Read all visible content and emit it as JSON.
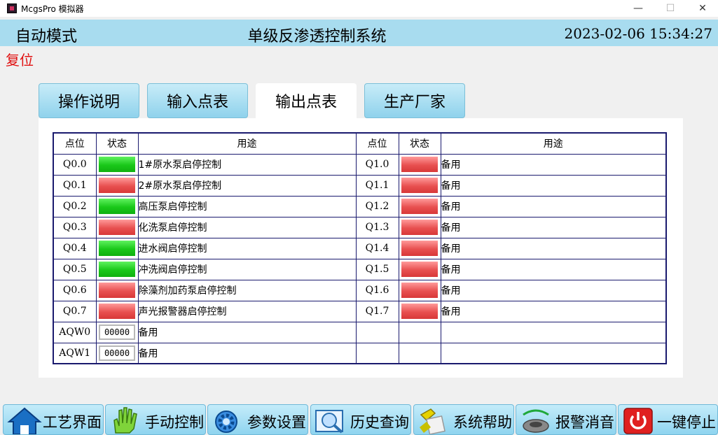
{
  "window": {
    "title": "McgsPro 模拟器",
    "min": "—",
    "max": "☐",
    "close": "✕"
  },
  "header": {
    "mode": "自动模式",
    "title": "单级反渗透控制系统",
    "datetime": "2023-02-06 15:34:27"
  },
  "reset_label": "复位",
  "tabs": [
    {
      "label": "操作说明",
      "active": false
    },
    {
      "label": "输入点表",
      "active": false
    },
    {
      "label": "输出点表",
      "active": true
    },
    {
      "label": "生产厂家",
      "active": false
    }
  ],
  "table": {
    "headers": {
      "addr": "点位",
      "status": "状态",
      "use": "用途"
    },
    "left": [
      {
        "addr": "Q0.0",
        "status": "on",
        "use": "1#原水泵启停控制"
      },
      {
        "addr": "Q0.1",
        "status": "off",
        "use": "2#原水泵启停控制"
      },
      {
        "addr": "Q0.2",
        "status": "on",
        "use": "高压泵启停控制"
      },
      {
        "addr": "Q0.3",
        "status": "off",
        "use": "化洗泵启停控制"
      },
      {
        "addr": "Q0.4",
        "status": "on",
        "use": "进水阀启停控制"
      },
      {
        "addr": "Q0.5",
        "status": "on",
        "use": "冲洗阀启停控制"
      },
      {
        "addr": "Q0.6",
        "status": "off",
        "use": "除藻剂加药泵启停控制"
      },
      {
        "addr": "Q0.7",
        "status": "off",
        "use": "声光报警器启停控制"
      },
      {
        "addr": "AQW0",
        "value": "00000",
        "use": "备用"
      },
      {
        "addr": "AQW1",
        "value": "00000",
        "use": "备用"
      }
    ],
    "right": [
      {
        "addr": "Q1.0",
        "status": "off",
        "use": "备用"
      },
      {
        "addr": "Q1.1",
        "status": "off",
        "use": "备用"
      },
      {
        "addr": "Q1.2",
        "status": "off",
        "use": "备用"
      },
      {
        "addr": "Q1.3",
        "status": "off",
        "use": "备用"
      },
      {
        "addr": "Q1.4",
        "status": "off",
        "use": "备用"
      },
      {
        "addr": "Q1.5",
        "status": "off",
        "use": "备用"
      },
      {
        "addr": "Q1.6",
        "status": "off",
        "use": "备用"
      },
      {
        "addr": "Q1.7",
        "status": "off",
        "use": "备用"
      }
    ]
  },
  "colors": {
    "on": "#1ac81a",
    "off": "#e85050",
    "header_bg": "#a8dcef",
    "reset": "#e01010"
  },
  "nav": [
    {
      "label": "工艺界面",
      "icon": "home-icon"
    },
    {
      "label": "手动控制",
      "icon": "hand-icon"
    },
    {
      "label": "参数设置",
      "icon": "gear-icon"
    },
    {
      "label": "历史查询",
      "icon": "magnifier-icon"
    },
    {
      "label": "系统帮助",
      "icon": "help-icon"
    },
    {
      "label": "报警消音",
      "icon": "speaker-icon"
    },
    {
      "label": "一键停止",
      "icon": "power-icon"
    }
  ]
}
